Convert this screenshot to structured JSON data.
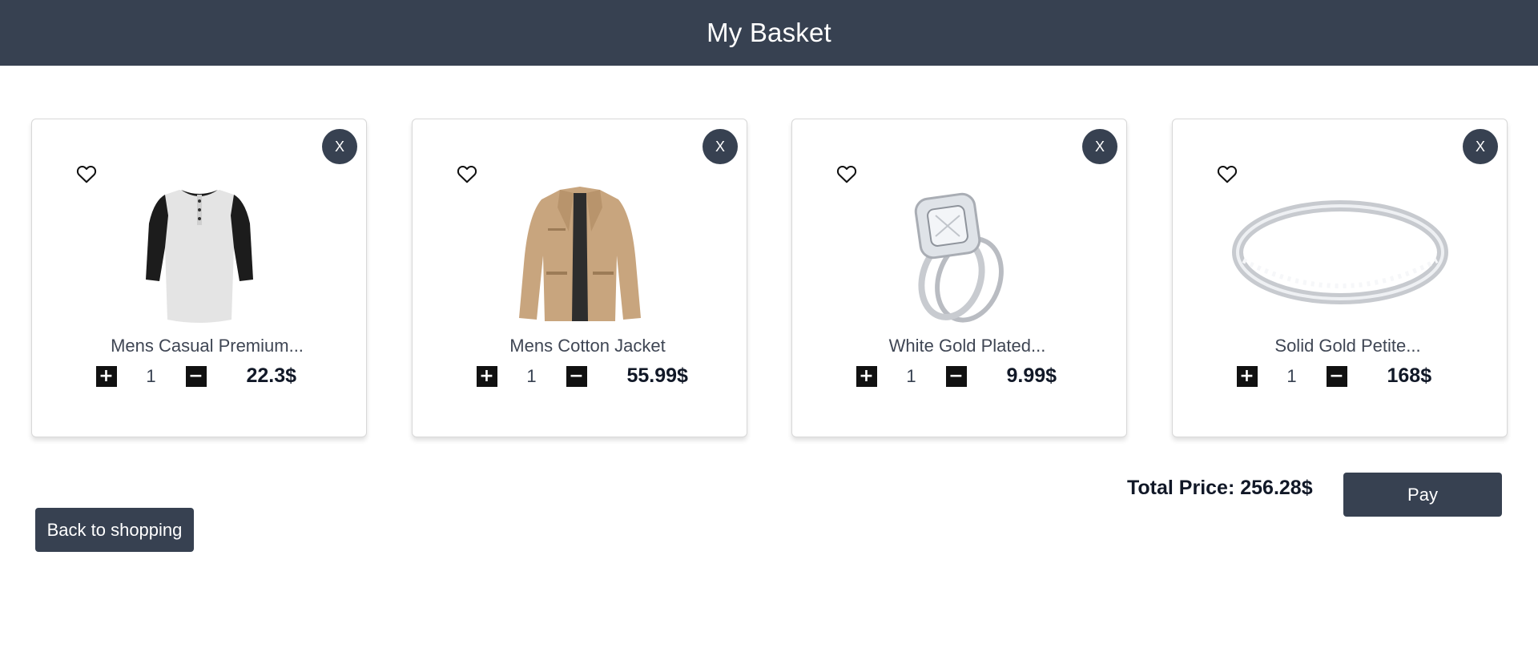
{
  "header": {
    "title": "My Basket"
  },
  "items": [
    {
      "name": "Mens Casual Premium...",
      "quantity": "1",
      "price": "22.3$",
      "remove_label": "X",
      "image": "tshirt-image"
    },
    {
      "name": "Mens Cotton Jacket",
      "quantity": "1",
      "price": "55.99$",
      "remove_label": "X",
      "image": "jacket-image"
    },
    {
      "name": "White Gold Plated...",
      "quantity": "1",
      "price": "9.99$",
      "remove_label": "X",
      "image": "ring-set-image"
    },
    {
      "name": "Solid Gold Petite...",
      "quantity": "1",
      "price": "168$",
      "remove_label": "X",
      "image": "band-ring-image"
    }
  ],
  "summary": {
    "total_label": "Total Price: 256.28$"
  },
  "actions": {
    "pay_label": "Pay",
    "back_label": "Back to shopping"
  },
  "icons": {
    "favorite": "heart-outline-icon",
    "increase": "plus-icon",
    "decrease": "minus-icon"
  },
  "colors": {
    "header": "#374151",
    "button": "#374151",
    "qty_button": "#111111"
  }
}
